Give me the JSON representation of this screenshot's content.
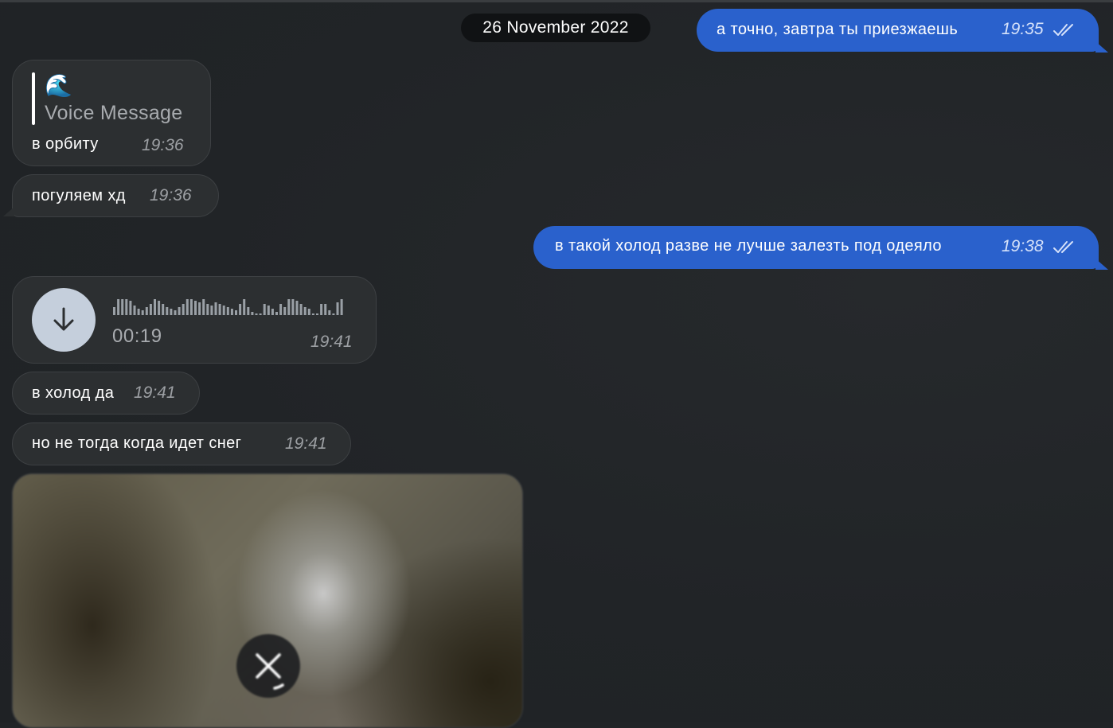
{
  "date_separator": "26 November 2022",
  "messages": [
    {
      "direction": "outgoing",
      "type": "text",
      "text": "а точно, завтра ты приезжаешь",
      "time": "19:35",
      "status": "read"
    },
    {
      "direction": "incoming",
      "type": "reply",
      "reply_emoji": "🌊",
      "reply_label": "Voice Message",
      "text": "в орбиту",
      "time": "19:36"
    },
    {
      "direction": "incoming",
      "type": "text",
      "text": "погуляем хд",
      "time": "19:36"
    },
    {
      "direction": "outgoing",
      "type": "text",
      "text": "в такой холод разве не лучше залезть под одеяло",
      "time": "19:38",
      "status": "read"
    },
    {
      "direction": "incoming",
      "type": "voice",
      "duration": "00:19",
      "time": "19:41",
      "icons": [
        "download-arrow-icon",
        "waveform-icon"
      ]
    },
    {
      "direction": "incoming",
      "type": "text",
      "text": "в холод да",
      "time": "19:41"
    },
    {
      "direction": "incoming",
      "type": "text",
      "text": "но не тогда когда идет снег",
      "time": "19:41"
    },
    {
      "direction": "incoming",
      "type": "media",
      "state": "downloading",
      "icons": [
        "close-icon"
      ]
    }
  ],
  "colors": {
    "background": "#212427",
    "incoming_bubble": "#2c2f31",
    "outgoing_bubble": "#2a61cc",
    "date_pill": "#101214",
    "secondary_text": "#a8abaf"
  }
}
